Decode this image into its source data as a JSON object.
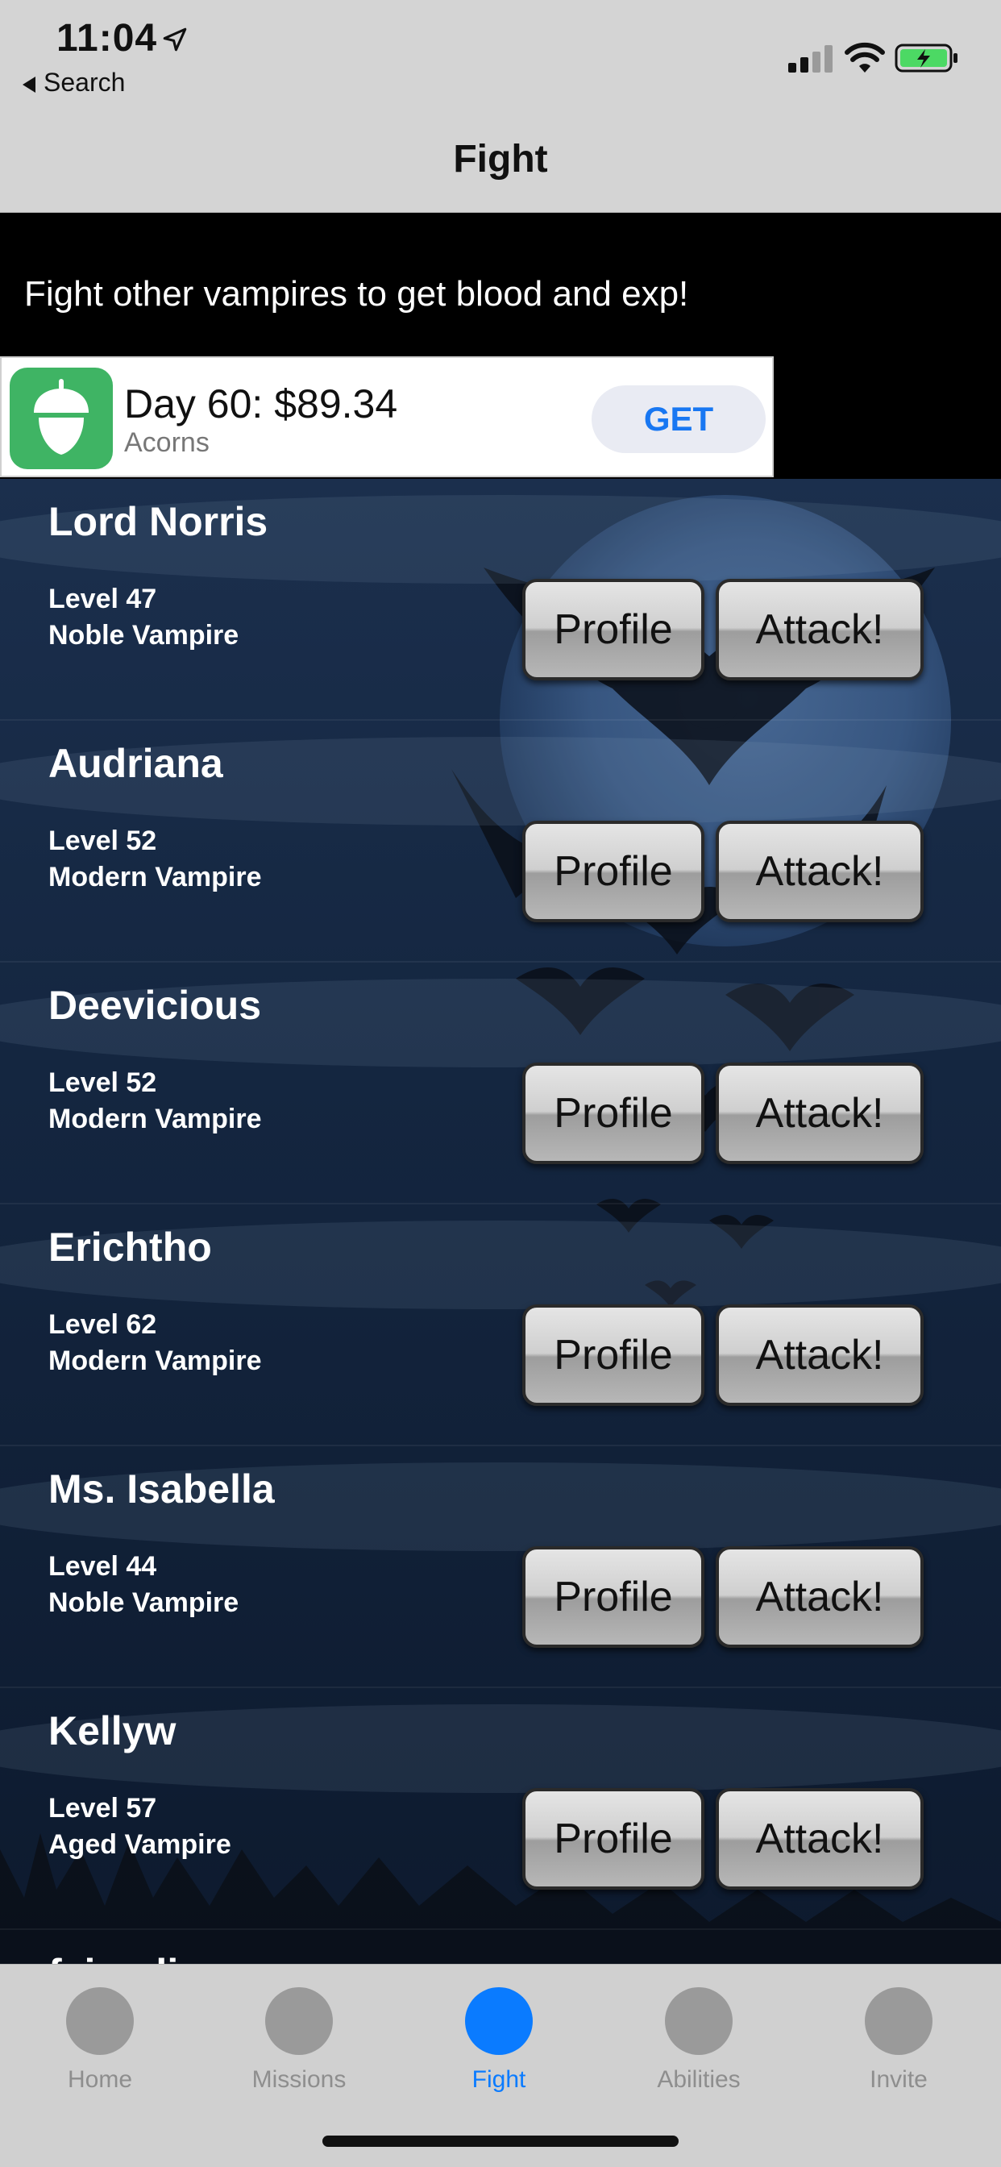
{
  "status_bar": {
    "time": "11:04",
    "back_label": "Search",
    "icons": [
      "location-arrow-icon",
      "signal-icon",
      "wifi-icon",
      "battery-charging-icon"
    ]
  },
  "nav": {
    "title": "Fight"
  },
  "intro": {
    "text": "Fight other vampires to get blood and exp!"
  },
  "ad": {
    "title": "Day 60: $89.34",
    "subtitle": "Acorns",
    "button": "GET",
    "icon": "acorn-icon"
  },
  "fighters": [
    {
      "name": "Lord Norris",
      "level": "Level 47",
      "type": "Noble Vampire",
      "profile": "Profile",
      "attack": "Attack!"
    },
    {
      "name": "Audriana",
      "level": "Level 52",
      "type": "Modern Vampire",
      "profile": "Profile",
      "attack": "Attack!"
    },
    {
      "name": "Deevicious",
      "level": "Level 52",
      "type": "Modern Vampire",
      "profile": "Profile",
      "attack": "Attack!"
    },
    {
      "name": "Erichtho",
      "level": "Level 62",
      "type": "Modern Vampire",
      "profile": "Profile",
      "attack": "Attack!"
    },
    {
      "name": "Ms. Isabella",
      "level": "Level 44",
      "type": "Noble Vampire",
      "profile": "Profile",
      "attack": "Attack!"
    },
    {
      "name": "Kellyw",
      "level": "Level 57",
      "type": "Aged Vampire",
      "profile": "Profile",
      "attack": "Attack!"
    }
  ],
  "partial_next_name": "fairyalia",
  "tabs": [
    {
      "label": "Home",
      "active": false
    },
    {
      "label": "Missions",
      "active": false
    },
    {
      "label": "Fight",
      "active": true
    },
    {
      "label": "Abilities",
      "active": false
    },
    {
      "label": "Invite",
      "active": false
    }
  ],
  "colors": {
    "accent": "#0a7bff",
    "ad_icon": "#3fb464",
    "ad_button_text": "#1877f2"
  }
}
